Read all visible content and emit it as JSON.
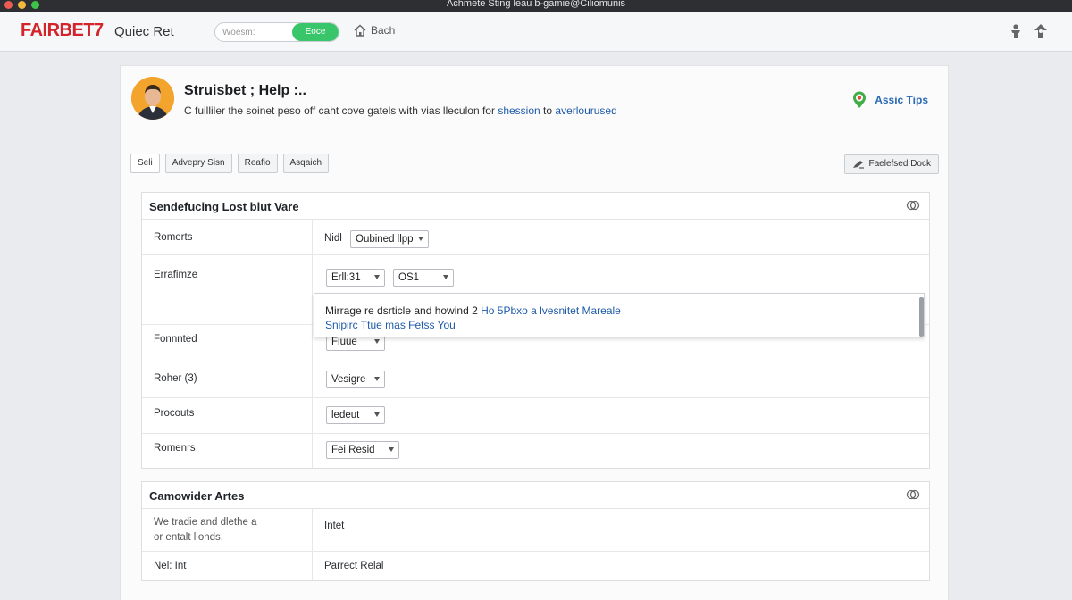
{
  "window": {
    "title": "Achmete Sting leau b-gamie@Ciliomunis"
  },
  "header": {
    "brand": "FAIRBET7",
    "brand_sub": "Quiec Ret",
    "search_placeholder": "Woesm:",
    "search_button": "Eoce",
    "home_label": "Bach"
  },
  "page": {
    "title": "Struisbet ; Help :..",
    "description": "C fuilliler the soinet peso off caht cove gatels with vias lleculon for",
    "description_link1": "shession",
    "description_mid": "to",
    "description_link2": "averlourused",
    "tips_label": "Assic Tips"
  },
  "tabs": [
    {
      "label": "Seli",
      "active": true
    },
    {
      "label": "Advepry Sisn",
      "active": false
    },
    {
      "label": "Reafio",
      "active": false
    },
    {
      "label": "Asqaich",
      "active": false
    }
  ],
  "feedback_button": "Faelefsed Dock",
  "section1": {
    "title": "Sendefucing Lost blut Vare",
    "rows": [
      {
        "label": "Romerts",
        "prefix": "Nidl",
        "select": "Oubined llpp"
      },
      {
        "label": "Errafimze",
        "select_a": "Erll:31",
        "select_b": "OS1"
      },
      {
        "label": "Fonnnted",
        "select": "Fiuue"
      },
      {
        "label": "Roher (3)",
        "select": "Vesigre"
      },
      {
        "label": "Procouts",
        "select": "ledeut"
      },
      {
        "label": "Romenrs",
        "select": "Fei Resid"
      }
    ],
    "popover": {
      "line1": "Mirrage re dsrticle and howind 2",
      "line1_link": "Ho 5Pbxo a lvesnitet Mareale",
      "line2": "Snipirc Ttue mas Fetss You"
    }
  },
  "section2": {
    "title": "Camowider Artes",
    "rows": [
      {
        "label_line1": "We tradie and dlethe a",
        "label_line2": "or entalt lionds.",
        "value": "Intet"
      },
      {
        "label": "Nel: Int",
        "value": "Parrect Relal"
      }
    ]
  },
  "colors": {
    "brand": "#d2242a",
    "accent_green": "#39c56a",
    "link_blue": "#1e5aa8"
  }
}
